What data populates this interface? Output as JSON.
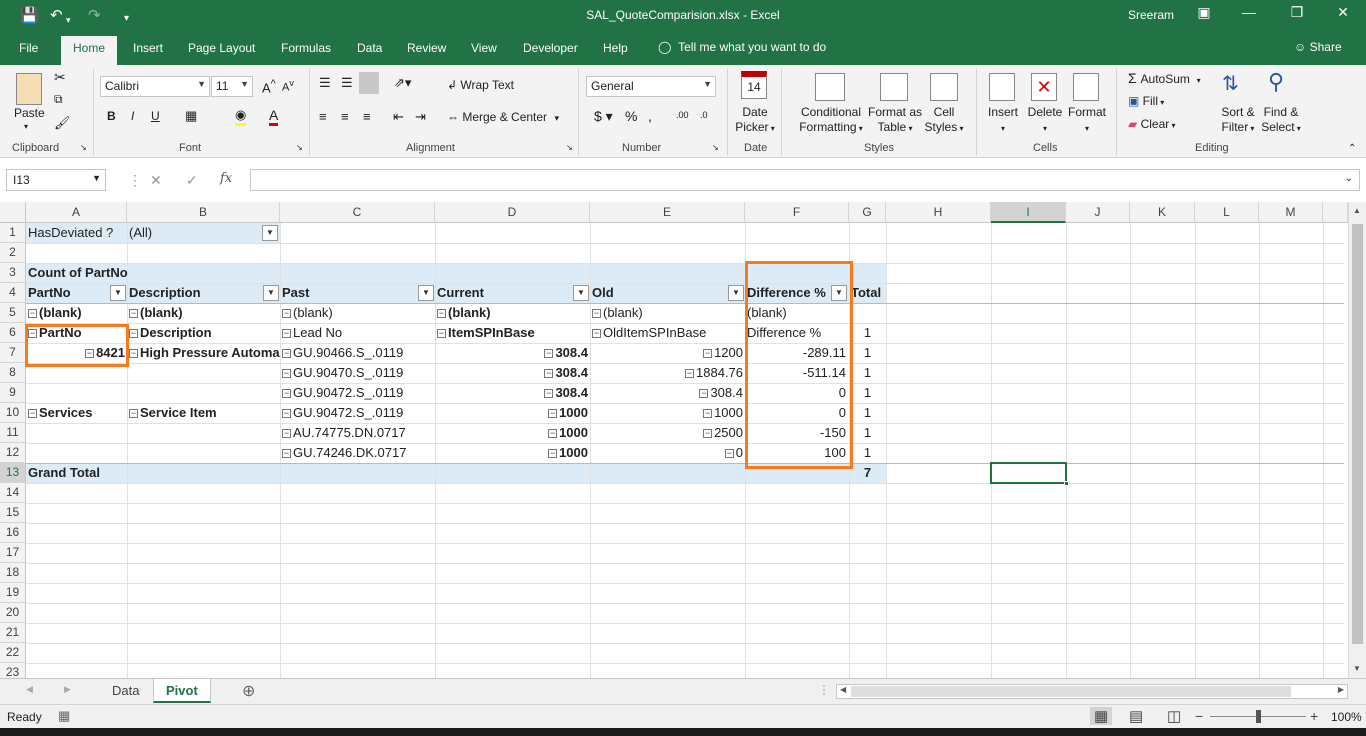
{
  "titlebar": {
    "title": "SAL_QuoteComparision.xlsx  -  Excel",
    "user": "Sreeram"
  },
  "tabs": [
    "File",
    "Home",
    "Insert",
    "Page Layout",
    "Formulas",
    "Data",
    "Review",
    "View",
    "Developer",
    "Help"
  ],
  "tell_me": "Tell me what you want to do",
  "share": "Share",
  "ribbon": {
    "clipboard": {
      "paste": "Paste",
      "label": "Clipboard"
    },
    "font": {
      "name": "Calibri",
      "size": "11",
      "label": "Font"
    },
    "alignment": {
      "wrap": "Wrap Text",
      "merge": "Merge & Center",
      "label": "Alignment"
    },
    "number": {
      "format": "General",
      "label": "Number"
    },
    "date": {
      "picker1": "Date",
      "picker2": "Picker",
      "calendar_day": "14",
      "label": "Date"
    },
    "styles": {
      "cond1": "Conditional",
      "cond2": "Formatting",
      "fmt1": "Format as",
      "fmt2": "Table",
      "cell1": "Cell",
      "cell2": "Styles",
      "label": "Styles"
    },
    "cells": {
      "insert": "Insert",
      "delete": "Delete",
      "format": "Format",
      "label": "Cells"
    },
    "editing": {
      "autosum": "AutoSum",
      "fill": "Fill",
      "clear": "Clear",
      "sort1": "Sort &",
      "sort2": "Filter",
      "find1": "Find &",
      "find2": "Select",
      "label": "Editing"
    }
  },
  "formula_bar": {
    "name_box": "I13",
    "formula": ""
  },
  "columns": [
    "A",
    "B",
    "C",
    "D",
    "E",
    "F",
    "G",
    "H",
    "I",
    "J",
    "K",
    "L",
    "M"
  ],
  "rows": [
    "1",
    "2",
    "3",
    "4",
    "5",
    "6",
    "7",
    "8",
    "9",
    "10",
    "11",
    "12",
    "13",
    "14",
    "15",
    "16",
    "17",
    "18",
    "19",
    "20",
    "21",
    "22",
    "23"
  ],
  "pivot": {
    "filter_label": "HasDeviated ?",
    "filter_value": "(All)",
    "count_label": "Count of PartNo",
    "headers": [
      "PartNo",
      "Description",
      "Past",
      "Current",
      "Old",
      "Difference %",
      "Total"
    ],
    "blank_row": [
      "(blank)",
      "(blank)",
      "(blank)",
      "(blank)",
      "(blank)",
      "(blank)"
    ],
    "field_row": [
      "PartNo",
      "Description",
      "Lead No",
      "ItemSPInBase",
      "OldItemSPInBase",
      "Difference %",
      "1"
    ],
    "data": [
      {
        "a": "8421",
        "b": "High Pressure Automa",
        "c": "GU.90466.S_.0119",
        "d": "308.4",
        "e": "1200",
        "f": "-289.11",
        "g": "1"
      },
      {
        "a": "",
        "b": "",
        "c": "GU.90470.S_.0119",
        "d": "308.4",
        "e": "1884.76",
        "f": "-511.14",
        "g": "1"
      },
      {
        "a": "",
        "b": "",
        "c": "GU.90472.S_.0119",
        "d": "308.4",
        "e": "308.4",
        "f": "0",
        "g": "1"
      },
      {
        "a": "Services",
        "b": "Service Item",
        "c": "GU.90472.S_.0119",
        "d": "1000",
        "e": "1000",
        "f": "0",
        "g": "1"
      },
      {
        "a": "",
        "b": "",
        "c": "AU.74775.DN.0717",
        "d": "1000",
        "e": "2500",
        "f": "-150",
        "g": "1"
      },
      {
        "a": "",
        "b": "",
        "c": "GU.74246.DK.0717",
        "d": "1000",
        "e": "0",
        "f": "100",
        "g": "1"
      }
    ],
    "grand_total_label": "Grand Total",
    "grand_total": "7"
  },
  "sheets": [
    "Data",
    "Pivot"
  ],
  "active_sheet": "Pivot",
  "status": {
    "ready": "Ready",
    "zoom": "100%"
  },
  "colors": {
    "excel_green": "#217346",
    "pivot_band": "#ddebf7",
    "highlight": "#f47b20"
  }
}
